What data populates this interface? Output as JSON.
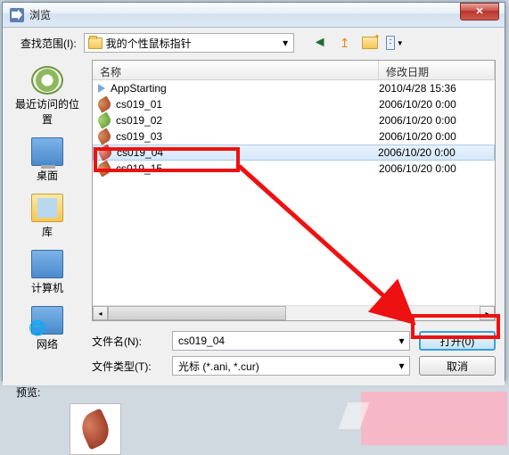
{
  "window": {
    "title": "浏览"
  },
  "lookin": {
    "label": "查找范围(I):",
    "value": "我的个性鼠标指针"
  },
  "places": {
    "recent": "最近访问的位置",
    "desktop": "桌面",
    "library": "库",
    "computer": "计算机",
    "network": "网络"
  },
  "columns": {
    "name": "名称",
    "date": "修改日期"
  },
  "files": [
    {
      "name": "AppStarting",
      "date": "2010/4/28 15:36",
      "icon": "arrow"
    },
    {
      "name": "cs019_01",
      "date": "2006/10/20 0:00",
      "icon": "leaf"
    },
    {
      "name": "cs019_02",
      "date": "2006/10/20 0:00",
      "icon": "leaf-green"
    },
    {
      "name": "cs019_03",
      "date": "2006/10/20 0:00",
      "icon": "leaf"
    },
    {
      "name": "cs019_04",
      "date": "2006/10/20 0:00",
      "icon": "leaf-red",
      "selected": true
    },
    {
      "name": "cs019_15",
      "date": "2006/10/20 0:00",
      "icon": "leaf"
    }
  ],
  "filename_label": "文件名(N):",
  "filetype_label": "文件类型(T):",
  "filename_value": "cs019_04",
  "filetype_value": "光标 (*.ani, *.cur)",
  "open_btn": "打开(0)",
  "cancel_btn": "取消",
  "preview_label": "预览:"
}
